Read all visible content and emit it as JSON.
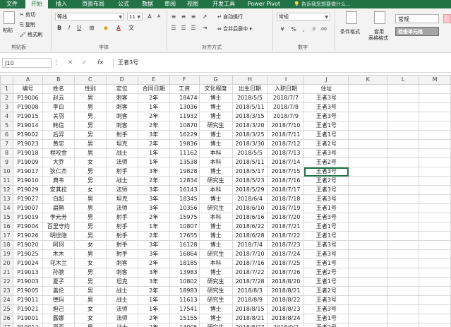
{
  "ribbon_tabs": [
    "文件",
    "开始",
    "插入",
    "页面布局",
    "公式",
    "数据",
    "审阅",
    "视图",
    "开发工具",
    "Power Pivot"
  ],
  "active_tab": "开始",
  "tell_me": "告诉我您想要做什么...",
  "clipboard": {
    "paste": "粘贴",
    "cut": "剪切",
    "copy": "复制",
    "format_painter": "格式刷",
    "label": "剪贴板"
  },
  "font": {
    "name": "等线",
    "size": "11",
    "label": "字体"
  },
  "alignment": {
    "wrap": "自动换行",
    "merge": "合并后居中",
    "label": "对齐方式"
  },
  "number": {
    "format": "常规",
    "label": "数字"
  },
  "styles": {
    "conditional": "条件格式",
    "table_line1": "套用",
    "table_line2": "表格格式",
    "normal": "常规",
    "check_cell": "检查单元格"
  },
  "name_box": "J10",
  "formula_value": "王者3号",
  "columns": [
    "A",
    "B",
    "C",
    "D",
    "E",
    "F",
    "G",
    "H",
    "I",
    "J",
    "K",
    "L",
    "M"
  ],
  "rows": [
    [
      "编号",
      "姓名",
      "性别",
      "定位",
      "合同日期",
      "工资",
      "文化程度",
      "出生日期",
      "入职日期",
      "住址"
    ],
    [
      "P19006",
      "赵云",
      "男",
      "刺客",
      "2年",
      "18474",
      "博士",
      "2018/5/5",
      "2018/7/7",
      "王者3号"
    ],
    [
      "P19008",
      "李白",
      "男",
      "刺客",
      "1年",
      "13036",
      "博士",
      "2018/5/11",
      "2018/7/8",
      "王者3号"
    ],
    [
      "P19015",
      "关羽",
      "男",
      "刺客",
      "2年",
      "11932",
      "博士",
      "2018/3/15",
      "2018/7/9",
      "王者3号"
    ],
    [
      "P19014",
      "韩信",
      "男",
      "刺客",
      "2年",
      "10870",
      "研究生",
      "2018/3/20",
      "2018/7/10",
      "王者1号"
    ],
    [
      "P19002",
      "后羿",
      "男",
      "射手",
      "3年",
      "16229",
      "博士",
      "2018/3/25",
      "2018/7/11",
      "王者1号"
    ],
    [
      "P19023",
      "黄忠",
      "男",
      "坦克",
      "2年",
      "19836",
      "博士",
      "2018/3/30",
      "2018/7/12",
      "王者2号"
    ],
    [
      "P19018",
      "程咬金",
      "男",
      "战士",
      "1年",
      "11162",
      "本科",
      "2018/5/5",
      "2018/7/13",
      "王者3号"
    ],
    [
      "P19009",
      "大乔",
      "女",
      "法师",
      "1年",
      "13538",
      "本科",
      "2018/5/11",
      "2018/7/14",
      "王者2号"
    ],
    [
      "P19017",
      "狄仁杰",
      "男",
      "射手",
      "3年",
      "19828",
      "博士",
      "2018/5/17",
      "2018/7/15",
      "王者3号"
    ],
    [
      "P19010",
      "典韦",
      "男",
      "战士",
      "2年",
      "12834",
      "研究生",
      "2018/5/23",
      "2018/7/16",
      "王者2号"
    ],
    [
      "P19029",
      "安其拉",
      "女",
      "法师",
      "3年",
      "16143",
      "本科",
      "2018/5/29",
      "2018/7/17",
      "王者3号"
    ],
    [
      "P19027",
      "白起",
      "男",
      "坦克",
      "3年",
      "18345",
      "博士",
      "2018/6/4",
      "2018/7/18",
      "王者3号"
    ],
    [
      "P19007",
      "扁鹊",
      "男",
      "法师",
      "3年",
      "10356",
      "研究生",
      "2018/6/10",
      "2018/7/19",
      "王者1号"
    ],
    [
      "P19019",
      "李元芳",
      "男",
      "射手",
      "2年",
      "15975",
      "本科",
      "2018/6/16",
      "2018/7/20",
      "王者3号"
    ],
    [
      "P19004",
      "百里守约",
      "男",
      "射手",
      "1年",
      "10807",
      "博士",
      "2018/6/22",
      "2018/7/21",
      "王者1号"
    ],
    [
      "P19026",
      "明世隐",
      "男",
      "射手",
      "2年",
      "17655",
      "博士",
      "2018/6/28",
      "2018/7/22",
      "王者1号"
    ],
    [
      "P19020",
      "阿珂",
      "女",
      "射手",
      "3年",
      "16128",
      "博士",
      "2018/7/4",
      "2018/7/23",
      "王者3号"
    ],
    [
      "P19025",
      "木木",
      "男",
      "射手",
      "3年",
      "16864",
      "研究生",
      "2018/7/10",
      "2018/7/24",
      "王者3号"
    ],
    [
      "P19024",
      "花木兰",
      "女",
      "刺客",
      "2年",
      "18185",
      "本科",
      "2018/7/16",
      "2018/7/25",
      "王者1号"
    ],
    [
      "P19013",
      "孙膑",
      "男",
      "刺客",
      "3年",
      "13983",
      "博士",
      "2018/7/22",
      "2018/7/26",
      "王者2号"
    ],
    [
      "P19003",
      "夏子",
      "男",
      "坦克",
      "3年",
      "10802",
      "研究生",
      "2018/7/28",
      "2018/8/20",
      "王者1号"
    ],
    [
      "P19005",
      "盖伦",
      "男",
      "战士",
      "2年",
      "18983",
      "研究生",
      "2018/8/3",
      "2018/8/21",
      "王者2号"
    ],
    [
      "P19011",
      "德玛",
      "男",
      "战士",
      "1年",
      "11613",
      "研究生",
      "2018/8/9",
      "2018/8/22",
      "王者3号"
    ],
    [
      "P19021",
      "妲己",
      "女",
      "法师",
      "1年",
      "17541",
      "博士",
      "2018/8/15",
      "2018/8/23",
      "王者3号"
    ],
    [
      "P19001",
      "露娜",
      "女",
      "法师",
      "2年",
      "15155",
      "博士",
      "2018/8/21",
      "2018/8/24",
      "王者1号"
    ],
    [
      "P19012",
      "西亚",
      "男",
      "战士",
      "2年",
      "14905",
      "研究生",
      "2018/8/27",
      "2018/9/2",
      "王者2号"
    ]
  ]
}
